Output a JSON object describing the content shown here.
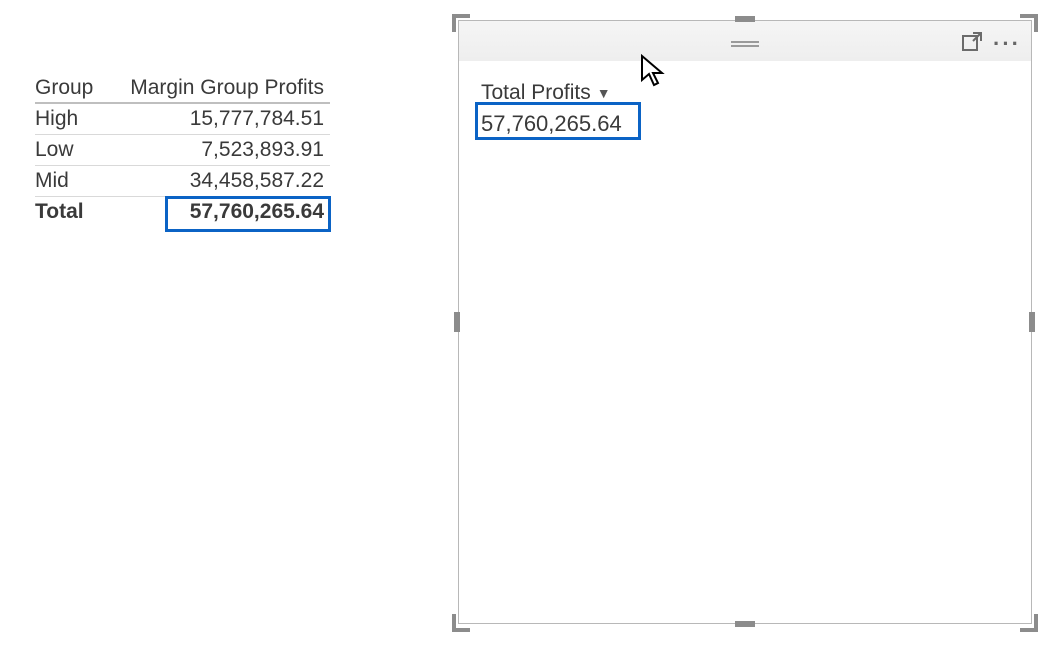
{
  "left_table": {
    "header_group": "Group",
    "header_value": "Margin Group Profits",
    "rows": {
      "r0_group": "High",
      "r0_value": "15,777,784.51",
      "r1_group": "Low",
      "r1_value": "7,523,893.91",
      "r2_group": "Mid",
      "r2_value": "34,458,587.22"
    },
    "total_label": "Total",
    "total_value": "57,760,265.64"
  },
  "card": {
    "field_label": "Total Profits",
    "value": "57,760,265.64"
  },
  "icons": {
    "focus_mode": "focus-mode-icon",
    "more": "more-options-icon",
    "grip": "drag-grip-icon",
    "sort_chevron": "sort-chevron-icon"
  },
  "chart_data": {
    "type": "table",
    "columns": [
      "Group",
      "Margin Group Profits"
    ],
    "rows": [
      [
        "High",
        15777784.51
      ],
      [
        "Low",
        7523893.91
      ],
      [
        "Mid",
        34458587.22
      ]
    ],
    "total": [
      "Total",
      57760265.64
    ],
    "card_visual": {
      "label": "Total Profits",
      "value": 57760265.64
    }
  }
}
